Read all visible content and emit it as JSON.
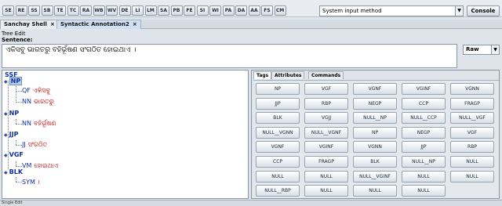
{
  "toolbar": {
    "languages": [
      "SE",
      "RE",
      "SS",
      "SB",
      "TE",
      "TC",
      "RA",
      "WB",
      "WV",
      "DE",
      "LI",
      "LM",
      "SA",
      "PB",
      "FE",
      "SI",
      "WI",
      "PA",
      "DA",
      "AA",
      "FS",
      "CM"
    ],
    "input_method": "System input method",
    "console_label": "Console"
  },
  "doc_tabs": [
    {
      "label": "Sanchay Shell",
      "close": "×"
    },
    {
      "label": "Syntactic Annotation2",
      "close": "×"
    }
  ],
  "editor": {
    "tree_edit_label": "Tree Edit",
    "sentence_label": "Sentence:",
    "sentence_text": "ଏକିସବୁ ଭାରତରୁ ବହିର୍ଭୂଷଣ ସଂଗଠିତ ହୋଇଥାଏ ।",
    "view_mode": "Raw"
  },
  "tree": {
    "root": "SSF",
    "nodes": [
      {
        "tag": "NP",
        "children": [
          {
            "tag": "QF",
            "word": "ଏକିସବୁ"
          },
          {
            "tag": "NN",
            "word": "ଭାରତରୁ"
          }
        ]
      },
      {
        "tag": "NP",
        "children": [
          {
            "tag": "NN",
            "word": "ବହିର୍ଭୂଷଣ"
          }
        ]
      },
      {
        "tag": "JJP",
        "children": [
          {
            "tag": "JJ",
            "word": "ସଂଗଠିତ"
          }
        ]
      },
      {
        "tag": "VGF",
        "children": [
          {
            "tag": "VM",
            "word": "ହୋଇଥାଏ"
          }
        ]
      },
      {
        "tag": "BLK",
        "children": [
          {
            "tag": "SYM",
            "word": "।"
          }
        ]
      }
    ]
  },
  "tag_panel": {
    "tabs": [
      "Tags",
      "Attributes",
      "Commands"
    ],
    "buttons": [
      "NP",
      "VGF",
      "VGNF",
      "VGINF",
      "VGNN",
      "JJP",
      "RBP",
      "NEGP",
      "CCP",
      "FRAGP",
      "BLK",
      "VGJJ",
      "NULL__NP",
      "NULL__CCP",
      "NULL__VGF",
      "NULL__VGNN",
      "NULL__VGNF",
      "NP",
      "NEGP",
      "VGF",
      "VGNF",
      "VGINF",
      "VGNN",
      "JJP",
      "RBP",
      "CCP",
      "FRAGP",
      "BLK",
      "NULL__NP",
      "NULL",
      "NULL",
      "NULL",
      "NULL__VGINF",
      "NULL",
      "NULL",
      "NULL__RBP",
      "NULL",
      "NULL",
      "NULL"
    ]
  },
  "status": {
    "text": "Single Edit"
  }
}
